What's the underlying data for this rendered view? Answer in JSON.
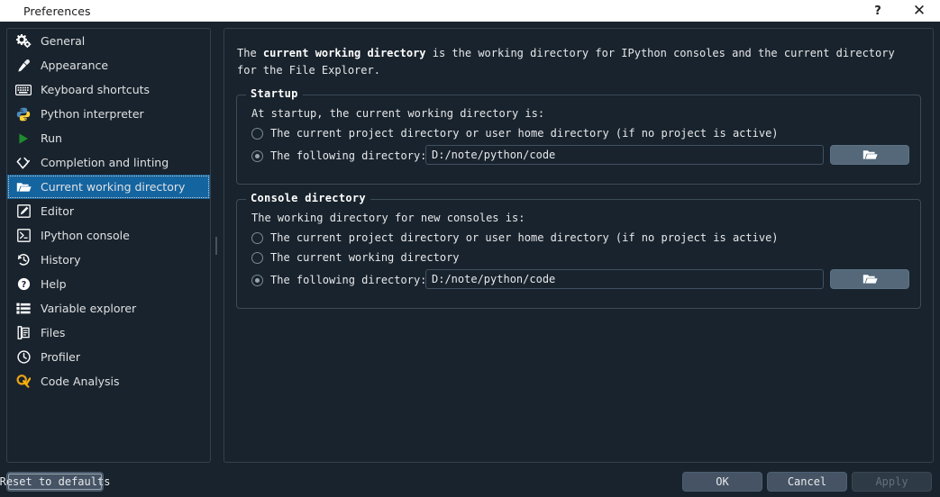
{
  "titlebar": {
    "title": "Preferences",
    "help_label": "?",
    "close_label": "✕"
  },
  "sidebar": {
    "items": [
      {
        "label": "General",
        "icon": "gears-icon",
        "selected": false
      },
      {
        "label": "Appearance",
        "icon": "eyedropper-icon",
        "selected": false
      },
      {
        "label": "Keyboard shortcuts",
        "icon": "keyboard-icon",
        "selected": false
      },
      {
        "label": "Python interpreter",
        "icon": "python-logo-icon",
        "selected": false
      },
      {
        "label": "Run",
        "icon": "play-triangle-icon",
        "selected": false
      },
      {
        "label": "Completion and linting",
        "icon": "code-check-icon",
        "selected": false
      },
      {
        "label": "Current working directory",
        "icon": "open-folder-icon",
        "selected": true
      },
      {
        "label": "Editor",
        "icon": "pencil-square-icon",
        "selected": false
      },
      {
        "label": "IPython console",
        "icon": "terminal-icon",
        "selected": false
      },
      {
        "label": "History",
        "icon": "history-clock-icon",
        "selected": false
      },
      {
        "label": "Help",
        "icon": "question-circle-icon",
        "selected": false
      },
      {
        "label": "Variable explorer",
        "icon": "list-table-icon",
        "selected": false
      },
      {
        "label": "Files",
        "icon": "files-icon",
        "selected": false
      },
      {
        "label": "Profiler",
        "icon": "clock-icon",
        "selected": false
      },
      {
        "label": "Code Analysis",
        "icon": "magnifier-check-icon",
        "selected": false
      }
    ]
  },
  "main": {
    "description_prefix": "The ",
    "description_bold": "current working directory",
    "description_suffix": " is the working directory for IPython consoles and the current directory for the File Explorer.",
    "startup": {
      "title": "Startup",
      "label": "At startup, the current working directory is:",
      "option_project": "The current project directory or user home directory (if no project is active)",
      "option_following": "The following directory:",
      "selected_option": "following",
      "path_value": "D:/note/python/code",
      "browse_icon": "open-folder-icon"
    },
    "console": {
      "title": "Console directory",
      "label": "The working directory for new consoles is:",
      "option_project": "The current project directory or user home directory (if no project is active)",
      "option_cwd": "The current working directory",
      "option_following": "The following directory:",
      "selected_option": "following",
      "path_value": "D:/note/python/code",
      "browse_icon": "open-folder-icon"
    }
  },
  "bottombar": {
    "reset_label": "Reset to defaults",
    "ok_label": "OK",
    "cancel_label": "Cancel",
    "apply_label": "Apply",
    "apply_disabled": true
  },
  "colors": {
    "window_bg": "#19232d",
    "titlebar_bg": "#ffffff",
    "selection_blue": "#1464a0",
    "button_bg": "#455364",
    "browse_bg": "#54687a",
    "border": "#32414b",
    "text": "#e6e8ea"
  }
}
